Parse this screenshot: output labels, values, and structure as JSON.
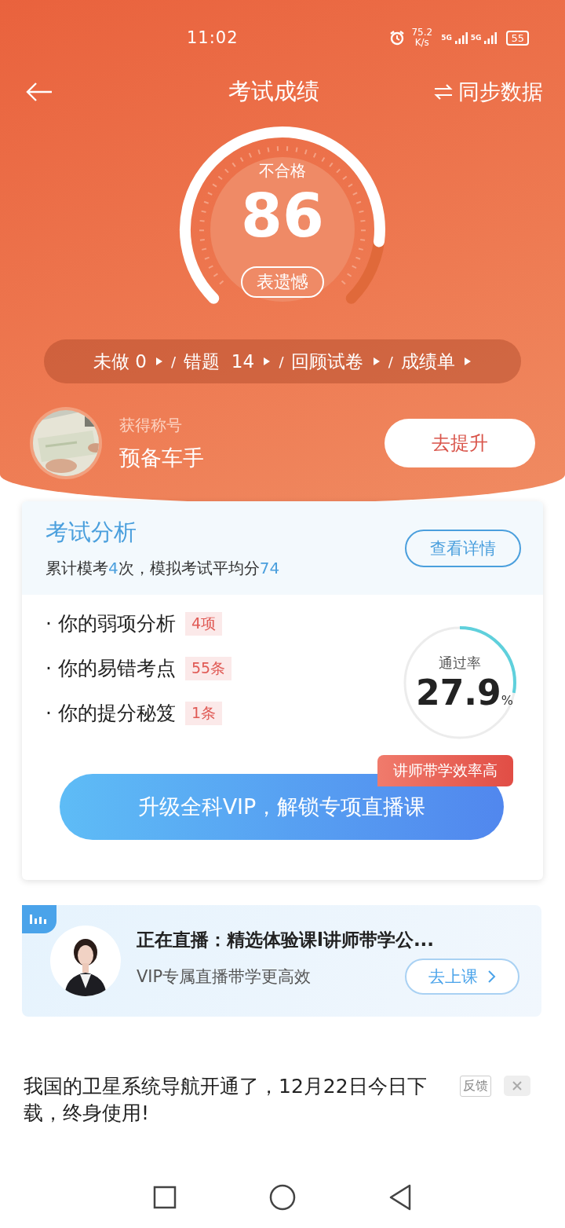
{
  "status_bar": {
    "time": "11:02",
    "speed_value": "75.2",
    "speed_unit": "K/s",
    "networks": [
      "5G",
      "5G"
    ],
    "battery": "55"
  },
  "nav": {
    "title": "考试成绩",
    "sync_label": "同步数据"
  },
  "score": {
    "verdict": "不合格",
    "value": "86",
    "button": "表遗憾"
  },
  "stats": [
    {
      "label": "未做 0"
    },
    {
      "separator": "/",
      "label": "错题  14"
    },
    {
      "separator": "/",
      "label": "回顾试卷"
    },
    {
      "separator": "/",
      "label": "成绩单"
    }
  ],
  "profile": {
    "caption": "获得称号",
    "title": "预备车手",
    "button": "去提升"
  },
  "analysis": {
    "title": "考试分析",
    "summary": [
      {
        "text": "累计模考",
        "highlight": false
      },
      {
        "text": "4",
        "highlight": true
      },
      {
        "text": "次，模拟考试平均分",
        "highlight": false
      },
      {
        "text": "74",
        "highlight": true
      }
    ],
    "details_button": "查看详情",
    "items": [
      {
        "label": "· 你的弱项分析",
        "count": "4项"
      },
      {
        "label": "· 你的易错考点",
        "count": "55条"
      },
      {
        "label": "· 你的提分秘笈",
        "count": "1条"
      }
    ],
    "pass_rate": {
      "label": "通过率",
      "value": "27.9",
      "unit": "%",
      "level": 0.279
    },
    "upgrade_button": "升级全科VIP，解锁专项直播课",
    "badge": "讲师带学效率高"
  },
  "live": {
    "title": "正在直播：精选体验课l讲师带学公...",
    "subtitle": "VIP专属直播带学更高效",
    "button": "去上课"
  },
  "ad": {
    "text": "我国的卫星系统导航开通了，12月22日今日下载，终身使用!",
    "feedback": "反馈"
  }
}
